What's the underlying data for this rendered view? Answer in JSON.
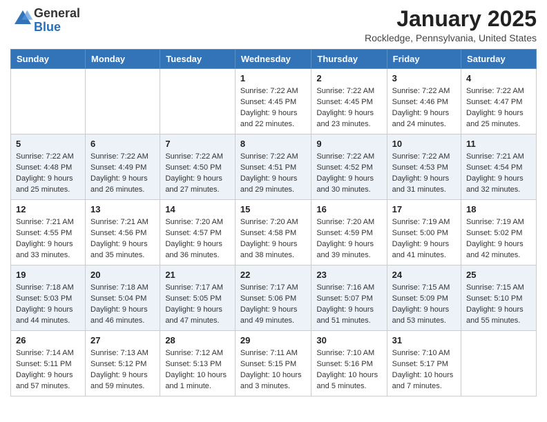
{
  "header": {
    "logo_general": "General",
    "logo_blue": "Blue",
    "month_title": "January 2025",
    "location": "Rockledge, Pennsylvania, United States"
  },
  "weekdays": [
    "Sunday",
    "Monday",
    "Tuesday",
    "Wednesday",
    "Thursday",
    "Friday",
    "Saturday"
  ],
  "weeks": [
    [
      {
        "day": "",
        "sunrise": "",
        "sunset": "",
        "daylight": ""
      },
      {
        "day": "",
        "sunrise": "",
        "sunset": "",
        "daylight": ""
      },
      {
        "day": "",
        "sunrise": "",
        "sunset": "",
        "daylight": ""
      },
      {
        "day": "1",
        "sunrise": "Sunrise: 7:22 AM",
        "sunset": "Sunset: 4:45 PM",
        "daylight": "Daylight: 9 hours and 22 minutes."
      },
      {
        "day": "2",
        "sunrise": "Sunrise: 7:22 AM",
        "sunset": "Sunset: 4:45 PM",
        "daylight": "Daylight: 9 hours and 23 minutes."
      },
      {
        "day": "3",
        "sunrise": "Sunrise: 7:22 AM",
        "sunset": "Sunset: 4:46 PM",
        "daylight": "Daylight: 9 hours and 24 minutes."
      },
      {
        "day": "4",
        "sunrise": "Sunrise: 7:22 AM",
        "sunset": "Sunset: 4:47 PM",
        "daylight": "Daylight: 9 hours and 25 minutes."
      }
    ],
    [
      {
        "day": "5",
        "sunrise": "Sunrise: 7:22 AM",
        "sunset": "Sunset: 4:48 PM",
        "daylight": "Daylight: 9 hours and 25 minutes."
      },
      {
        "day": "6",
        "sunrise": "Sunrise: 7:22 AM",
        "sunset": "Sunset: 4:49 PM",
        "daylight": "Daylight: 9 hours and 26 minutes."
      },
      {
        "day": "7",
        "sunrise": "Sunrise: 7:22 AM",
        "sunset": "Sunset: 4:50 PM",
        "daylight": "Daylight: 9 hours and 27 minutes."
      },
      {
        "day": "8",
        "sunrise": "Sunrise: 7:22 AM",
        "sunset": "Sunset: 4:51 PM",
        "daylight": "Daylight: 9 hours and 29 minutes."
      },
      {
        "day": "9",
        "sunrise": "Sunrise: 7:22 AM",
        "sunset": "Sunset: 4:52 PM",
        "daylight": "Daylight: 9 hours and 30 minutes."
      },
      {
        "day": "10",
        "sunrise": "Sunrise: 7:22 AM",
        "sunset": "Sunset: 4:53 PM",
        "daylight": "Daylight: 9 hours and 31 minutes."
      },
      {
        "day": "11",
        "sunrise": "Sunrise: 7:21 AM",
        "sunset": "Sunset: 4:54 PM",
        "daylight": "Daylight: 9 hours and 32 minutes."
      }
    ],
    [
      {
        "day": "12",
        "sunrise": "Sunrise: 7:21 AM",
        "sunset": "Sunset: 4:55 PM",
        "daylight": "Daylight: 9 hours and 33 minutes."
      },
      {
        "day": "13",
        "sunrise": "Sunrise: 7:21 AM",
        "sunset": "Sunset: 4:56 PM",
        "daylight": "Daylight: 9 hours and 35 minutes."
      },
      {
        "day": "14",
        "sunrise": "Sunrise: 7:20 AM",
        "sunset": "Sunset: 4:57 PM",
        "daylight": "Daylight: 9 hours and 36 minutes."
      },
      {
        "day": "15",
        "sunrise": "Sunrise: 7:20 AM",
        "sunset": "Sunset: 4:58 PM",
        "daylight": "Daylight: 9 hours and 38 minutes."
      },
      {
        "day": "16",
        "sunrise": "Sunrise: 7:20 AM",
        "sunset": "Sunset: 4:59 PM",
        "daylight": "Daylight: 9 hours and 39 minutes."
      },
      {
        "day": "17",
        "sunrise": "Sunrise: 7:19 AM",
        "sunset": "Sunset: 5:00 PM",
        "daylight": "Daylight: 9 hours and 41 minutes."
      },
      {
        "day": "18",
        "sunrise": "Sunrise: 7:19 AM",
        "sunset": "Sunset: 5:02 PM",
        "daylight": "Daylight: 9 hours and 42 minutes."
      }
    ],
    [
      {
        "day": "19",
        "sunrise": "Sunrise: 7:18 AM",
        "sunset": "Sunset: 5:03 PM",
        "daylight": "Daylight: 9 hours and 44 minutes."
      },
      {
        "day": "20",
        "sunrise": "Sunrise: 7:18 AM",
        "sunset": "Sunset: 5:04 PM",
        "daylight": "Daylight: 9 hours and 46 minutes."
      },
      {
        "day": "21",
        "sunrise": "Sunrise: 7:17 AM",
        "sunset": "Sunset: 5:05 PM",
        "daylight": "Daylight: 9 hours and 47 minutes."
      },
      {
        "day": "22",
        "sunrise": "Sunrise: 7:17 AM",
        "sunset": "Sunset: 5:06 PM",
        "daylight": "Daylight: 9 hours and 49 minutes."
      },
      {
        "day": "23",
        "sunrise": "Sunrise: 7:16 AM",
        "sunset": "Sunset: 5:07 PM",
        "daylight": "Daylight: 9 hours and 51 minutes."
      },
      {
        "day": "24",
        "sunrise": "Sunrise: 7:15 AM",
        "sunset": "Sunset: 5:09 PM",
        "daylight": "Daylight: 9 hours and 53 minutes."
      },
      {
        "day": "25",
        "sunrise": "Sunrise: 7:15 AM",
        "sunset": "Sunset: 5:10 PM",
        "daylight": "Daylight: 9 hours and 55 minutes."
      }
    ],
    [
      {
        "day": "26",
        "sunrise": "Sunrise: 7:14 AM",
        "sunset": "Sunset: 5:11 PM",
        "daylight": "Daylight: 9 hours and 57 minutes."
      },
      {
        "day": "27",
        "sunrise": "Sunrise: 7:13 AM",
        "sunset": "Sunset: 5:12 PM",
        "daylight": "Daylight: 9 hours and 59 minutes."
      },
      {
        "day": "28",
        "sunrise": "Sunrise: 7:12 AM",
        "sunset": "Sunset: 5:13 PM",
        "daylight": "Daylight: 10 hours and 1 minute."
      },
      {
        "day": "29",
        "sunrise": "Sunrise: 7:11 AM",
        "sunset": "Sunset: 5:15 PM",
        "daylight": "Daylight: 10 hours and 3 minutes."
      },
      {
        "day": "30",
        "sunrise": "Sunrise: 7:10 AM",
        "sunset": "Sunset: 5:16 PM",
        "daylight": "Daylight: 10 hours and 5 minutes."
      },
      {
        "day": "31",
        "sunrise": "Sunrise: 7:10 AM",
        "sunset": "Sunset: 5:17 PM",
        "daylight": "Daylight: 10 hours and 7 minutes."
      },
      {
        "day": "",
        "sunrise": "",
        "sunset": "",
        "daylight": ""
      }
    ]
  ]
}
